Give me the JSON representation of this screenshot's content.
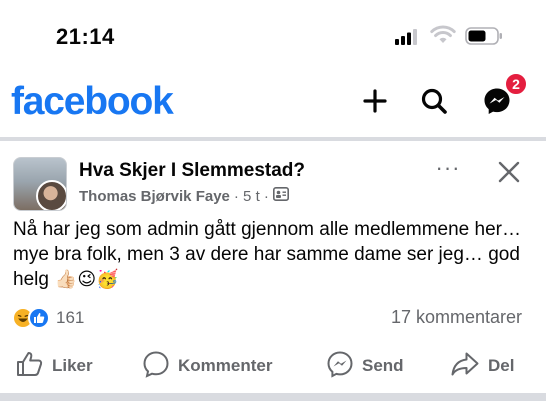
{
  "status_bar": {
    "time": "21:14"
  },
  "header": {
    "logo": "facebook",
    "messenger_badge": "2"
  },
  "post": {
    "group_name": "Hva Skjer I Slemmestad?",
    "author": "Thomas Bjørvik Faye",
    "time_ago": "· 5 t ·",
    "more_label": "···",
    "text": "Nå har jeg som admin gått gjennom alle medlemmene her… mye bra folk, men 3 av dere har samme dame ser jeg…  god helg",
    "emojis": "👍🏻😉🥳",
    "reaction_count": "161",
    "comment_count": "17 kommentarer"
  },
  "actions": {
    "like": "Liker",
    "comment": "Kommenter",
    "send": "Send",
    "share": "Del"
  },
  "icons": {
    "header": [
      "add-icon",
      "search-icon",
      "messenger-icon"
    ],
    "post": [
      "more-icon",
      "close-icon",
      "group-privacy-icon"
    ],
    "actions": [
      "thumbs-up-icon",
      "comment-icon",
      "messenger-icon",
      "share-icon"
    ]
  },
  "colors": {
    "brand": "#1877f2",
    "badge": "#e41e3f",
    "secondary_text": "#65676b"
  }
}
